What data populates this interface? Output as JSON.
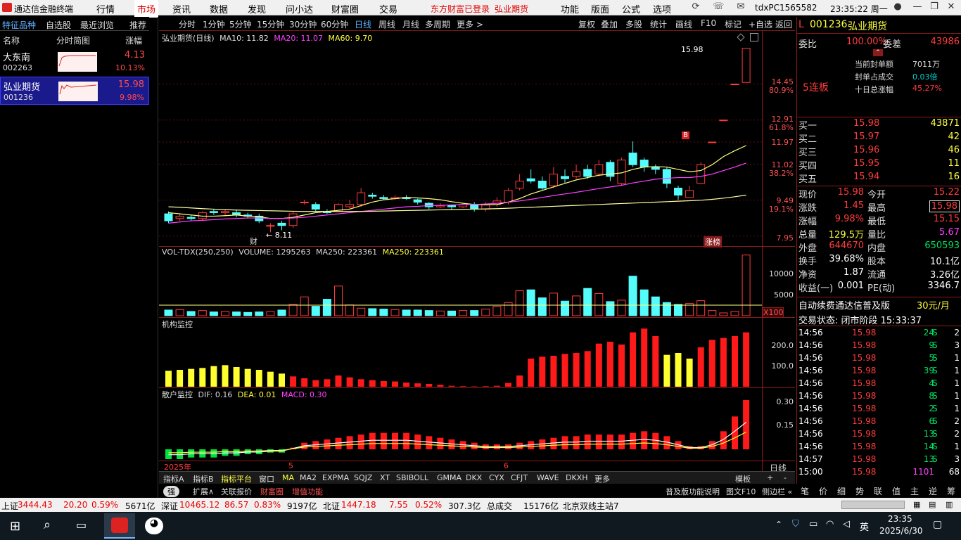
{
  "menubar": {
    "app_title": "通达信金融终端",
    "items": [
      "行情",
      "市场",
      "资讯",
      "数据",
      "发现",
      "问小达",
      "财富圈",
      "交易"
    ],
    "login": "东方财富已登录",
    "login_stock": "弘业期货",
    "items2": [
      "功能",
      "版面",
      "公式",
      "选项"
    ],
    "user": "tdxPC1565582",
    "clock": "23:35:22 周一"
  },
  "left_tabs": [
    "特征品种",
    "自选股",
    "最近浏览",
    "推荐"
  ],
  "left_header": {
    "name": "名称",
    "chart": "分时简图",
    "pct": "涨幅"
  },
  "stocks": [
    {
      "name": "大东南",
      "code": "002263",
      "price": "4.13",
      "pct": "10.13%"
    },
    {
      "name": "弘业期货",
      "code": "001236",
      "price": "15.98",
      "pct": "9.98%"
    }
  ],
  "toolbar": {
    "periods": [
      "分时",
      "1分钟",
      "5分钟",
      "15分钟",
      "30分钟",
      "60分钟",
      "日线",
      "周线",
      "月线",
      "多周期",
      "更多 >"
    ],
    "actions": [
      "复权",
      "叠加",
      "多股",
      "统计",
      "画线",
      "F10",
      "标记",
      "+自选",
      "返回"
    ]
  },
  "main_chart": {
    "title": "弘业期货(日线)",
    "ma10": "MA10: 11.82",
    "ma20": "MA20: 11.07",
    "ma60": "MA60: 9.70",
    "max_label": "15.98",
    "min_label": "← 8.11",
    "marker_b": "B",
    "marker_cai": "财",
    "badge": "涨榜"
  },
  "yaxis_main": [
    {
      "v": "14.45",
      "p": "80.9%"
    },
    {
      "v": "12.91",
      "p": "61.8%"
    },
    {
      "v": "11.97",
      "p": ""
    },
    {
      "v": "11.02",
      "p": "38.2%"
    },
    {
      "v": "9.49",
      "p": "19.1%"
    },
    {
      "v": "7.95",
      "p": ""
    }
  ],
  "vol_title": {
    "label": "VOL-TDX(250,250)",
    "volume": "VOLUME: 1295263",
    "ma1": "MA250: 223361",
    "ma2": "MA250: 223361"
  },
  "yaxis_vol": [
    "10000",
    "5000",
    "X100"
  ],
  "inst_title": "机构监控",
  "yaxis_inst": [
    "200.0",
    "100.0"
  ],
  "macd_title": {
    "label": "散户监控",
    "dif": "DIF: 0.16",
    "dea": "DEA: 0.01",
    "macd": "MACD: 0.30"
  },
  "yaxis_macd": [
    "0.30",
    "0.15"
  ],
  "date_axis": {
    "year": "2025年",
    "m5": "5",
    "m6": "6",
    "right": "日线"
  },
  "chart_data": {
    "type": "candlestick",
    "title": "弘业期货(日线)",
    "candles": [
      [
        8.9,
        8.6,
        9.0,
        8.5
      ],
      [
        8.7,
        8.8,
        8.9,
        8.6
      ],
      [
        8.75,
        8.7,
        8.85,
        8.6
      ],
      [
        8.7,
        8.95,
        9.0,
        8.6
      ],
      [
        9.0,
        8.95,
        9.1,
        8.85
      ],
      [
        8.95,
        9.0,
        9.1,
        8.8
      ],
      [
        8.95,
        8.85,
        9.05,
        8.75
      ],
      [
        8.85,
        8.8,
        8.95,
        8.7
      ],
      [
        8.8,
        8.6,
        8.9,
        8.5
      ],
      [
        8.4,
        8.4,
        8.5,
        8.11
      ],
      [
        8.5,
        8.4,
        8.6,
        8.2
      ],
      [
        8.4,
        8.9,
        9.0,
        8.3
      ],
      [
        9.4,
        9.4,
        9.5,
        9.3
      ],
      [
        9.3,
        9.1,
        9.4,
        9.0
      ],
      [
        9.0,
        8.95,
        9.1,
        8.9
      ],
      [
        9.0,
        9.3,
        9.35,
        9.0
      ],
      [
        9.2,
        9.3,
        9.5,
        9.1
      ],
      [
        9.3,
        9.8,
        10.0,
        9.2
      ],
      [
        9.7,
        9.65,
        9.8,
        9.55
      ],
      [
        9.6,
        9.55,
        9.7,
        9.5
      ],
      [
        9.55,
        9.6,
        9.7,
        9.5
      ],
      [
        9.6,
        9.55,
        9.7,
        9.5
      ],
      [
        9.5,
        9.4,
        9.55,
        9.3
      ],
      [
        9.35,
        9.2,
        9.4,
        9.1
      ],
      [
        9.2,
        9.25,
        9.35,
        9.15
      ],
      [
        9.25,
        9.2,
        9.3,
        9.1
      ],
      [
        9.2,
        9.3,
        9.35,
        9.15
      ],
      [
        9.3,
        9.1,
        9.4,
        9.0
      ],
      [
        9.1,
        9.3,
        9.4,
        9.0
      ],
      [
        9.3,
        9.45,
        9.6,
        9.2
      ],
      [
        9.4,
        9.9,
        10.0,
        9.3
      ],
      [
        10.0,
        10.3,
        10.6,
        9.9
      ],
      [
        10.4,
        10.3,
        10.8,
        10.2
      ],
      [
        10.3,
        10.0,
        10.5,
        9.9
      ],
      [
        10.1,
        10.6,
        10.9,
        10.0
      ],
      [
        10.5,
        10.4,
        10.8,
        10.2
      ],
      [
        10.5,
        10.7,
        11.0,
        10.4
      ],
      [
        10.8,
        10.5,
        11.0,
        10.4
      ],
      [
        10.6,
        11.0,
        11.2,
        10.5
      ],
      [
        11.1,
        10.5,
        11.2,
        10.3
      ],
      [
        10.2,
        11.2,
        11.3,
        10.1
      ],
      [
        11.5,
        11.0,
        12.0,
        10.9
      ],
      [
        11.2,
        10.9,
        11.3,
        10.7
      ],
      [
        10.9,
        10.8,
        11.0,
        10.6
      ],
      [
        10.8,
        10.2,
        10.9,
        10.0
      ],
      [
        10.0,
        9.7,
        10.1,
        9.5
      ],
      [
        9.6,
        9.9,
        10.1,
        9.6
      ],
      [
        10.2,
        11.0,
        11.1,
        10.2
      ],
      [
        11.97,
        11.97,
        11.97,
        11.97
      ],
      [
        12.91,
        12.91,
        12.91,
        12.91
      ],
      [
        14.45,
        14.45,
        14.45,
        14.45
      ],
      [
        14.52,
        15.98,
        15.98,
        14.52
      ]
    ],
    "ma10": [
      8.95,
      8.9,
      8.85,
      8.8,
      8.8,
      8.82,
      8.85,
      8.8,
      8.78,
      8.7,
      8.7,
      8.75,
      8.85,
      8.95,
      9.0,
      9.05,
      9.1,
      9.25,
      9.4,
      9.5,
      9.55,
      9.6,
      9.58,
      9.55,
      9.5,
      9.42,
      9.35,
      9.3,
      9.28,
      9.3,
      9.4,
      9.55,
      9.75,
      9.9,
      10.05,
      10.2,
      10.35,
      10.45,
      10.55,
      10.6,
      10.65,
      10.8,
      10.9,
      10.92,
      10.9,
      10.8,
      10.7,
      10.75,
      11.0,
      11.35,
      11.6,
      11.82
    ],
    "ma20": [
      8.5,
      8.55,
      8.6,
      8.62,
      8.65,
      8.68,
      8.7,
      8.72,
      8.72,
      8.7,
      8.7,
      8.72,
      8.75,
      8.8,
      8.85,
      8.9,
      8.95,
      9.0,
      9.05,
      9.1,
      9.15,
      9.2,
      9.22,
      9.25,
      9.26,
      9.28,
      9.3,
      9.3,
      9.32,
      9.35,
      9.4,
      9.45,
      9.52,
      9.6,
      9.68,
      9.75,
      9.82,
      9.9,
      9.98,
      10.05,
      10.12,
      10.22,
      10.3,
      10.38,
      10.42,
      10.45,
      10.45,
      10.5,
      10.6,
      10.75,
      10.9,
      11.07
    ],
    "ma60": [
      9.2,
      9.18,
      9.15,
      9.12,
      9.1,
      9.08,
      9.06,
      9.05,
      9.04,
      9.03,
      9.02,
      9.01,
      9.0,
      9.0,
      9.0,
      9.0,
      9.0,
      9.0,
      9.01,
      9.02,
      9.03,
      9.04,
      9.05,
      9.06,
      9.07,
      9.08,
      9.09,
      9.1,
      9.11,
      9.12,
      9.14,
      9.16,
      9.18,
      9.2,
      9.22,
      9.24,
      9.26,
      9.28,
      9.3,
      9.32,
      9.34,
      9.36,
      9.38,
      9.4,
      9.42,
      9.44,
      9.46,
      9.48,
      9.52,
      9.57,
      9.63,
      9.7
    ],
    "volume": [
      1200,
      1300,
      900,
      1100,
      800,
      900,
      800,
      700,
      800,
      900,
      1200,
      2400,
      4000,
      2000,
      3500,
      6300,
      2300,
      1600,
      1500,
      1400,
      1300,
      1200,
      1200,
      1100,
      1000,
      1000,
      1100,
      1100,
      1400,
      2000,
      2800,
      5300,
      5500,
      3800,
      4800,
      3100,
      4200,
      5800,
      4700,
      3000,
      3300,
      8400,
      5500,
      4000,
      2800,
      2400,
      2600,
      3200,
      1100,
      600,
      900,
      12900
    ],
    "institution": [
      85,
      90,
      95,
      100,
      110,
      115,
      105,
      95,
      90,
      80,
      70,
      55,
      45,
      35,
      40,
      60,
      50,
      40,
      35,
      30,
      28,
      22,
      18,
      15,
      10,
      5,
      3,
      2,
      3,
      5,
      20,
      60,
      150,
      160,
      165,
      175,
      180,
      190,
      230,
      240,
      225,
      290,
      310,
      270,
      170,
      180,
      150,
      210,
      250,
      260,
      270,
      290
    ],
    "macd": [
      -0.06,
      -0.06,
      -0.05,
      -0.05,
      -0.05,
      -0.04,
      -0.04,
      -0.03,
      -0.03,
      -0.02,
      -0.02,
      0.01,
      0.04,
      0.05,
      0.06,
      0.07,
      0.08,
      0.09,
      0.1,
      0.1,
      0.1,
      0.1,
      0.09,
      0.08,
      0.07,
      0.06,
      0.05,
      0.04,
      0.03,
      0.03,
      0.03,
      0.04,
      0.05,
      0.06,
      0.07,
      0.08,
      0.08,
      0.09,
      0.09,
      0.09,
      0.09,
      0.1,
      0.11,
      0.1,
      0.08,
      0.05,
      0.02,
      0.02,
      0.05,
      0.11,
      0.2,
      0.3
    ]
  },
  "right_panel": {
    "code": "001236",
    "name": "弘业期货",
    "weibi_label": "委比",
    "weibi": "100.00%",
    "weicha_label": "委差",
    "weicha": "43986",
    "seal_amt_label": "当前封单额",
    "seal_amt": "7011万",
    "seal_ratio_label": "封单占成交",
    "seal_ratio": "0.03倍",
    "ten_day_label": "十日总涨幅",
    "ten_day": "45.27%",
    "streak": "5连板",
    "bids": [
      {
        "l": "买一",
        "p": "15.98",
        "v": "43871"
      },
      {
        "l": "买二",
        "p": "15.97",
        "v": "42"
      },
      {
        "l": "买三",
        "p": "15.96",
        "v": "46"
      },
      {
        "l": "买四",
        "p": "15.95",
        "v": "11"
      },
      {
        "l": "买五",
        "p": "15.94",
        "v": "16"
      }
    ],
    "quote": [
      {
        "l": "现价",
        "v": "15.98",
        "l2": "今开",
        "v2": "15.22"
      },
      {
        "l": "涨跌",
        "v": "1.45",
        "l2": "最高",
        "v2": "15.98"
      },
      {
        "l": "涨幅",
        "v": "9.98%",
        "l2": "最低",
        "v2": "15.15"
      },
      {
        "l": "总量",
        "v": "129.5万",
        "l2": "量比",
        "v2": "5.67"
      },
      {
        "l": "外盘",
        "v": "644670",
        "l2": "内盘",
        "v2": "650593"
      },
      {
        "l": "换手",
        "v": "39.68%",
        "l2": "股本",
        "v2": "10.1亿"
      },
      {
        "l": "净资",
        "v": "1.87",
        "l2": "流通",
        "v2": "3.26亿"
      },
      {
        "l": "收益(一)",
        "v": "0.001",
        "l2": "PE(动)",
        "v2": "3346.7"
      }
    ],
    "ad": "自动续费通达信普及版",
    "ad_price": "30元/月",
    "trade_status": "交易状态: 闭市阶段 15:33:37",
    "ticks": [
      {
        "t": "14:56",
        "p": "15.98",
        "v": "24",
        "s": "S",
        "n": "2"
      },
      {
        "t": "14:56",
        "p": "15.98",
        "v": "9",
        "s": "S",
        "n": "3"
      },
      {
        "t": "14:56",
        "p": "15.98",
        "v": "5",
        "s": "S",
        "n": "1"
      },
      {
        "t": "14:56",
        "p": "15.98",
        "v": "39",
        "s": "S",
        "n": "1"
      },
      {
        "t": "14:56",
        "p": "15.98",
        "v": "4",
        "s": "S",
        "n": "1"
      },
      {
        "t": "14:56",
        "p": "15.98",
        "v": "8",
        "s": "S",
        "n": "1"
      },
      {
        "t": "14:56",
        "p": "15.98",
        "v": "2",
        "s": "S",
        "n": "1"
      },
      {
        "t": "14:56",
        "p": "15.98",
        "v": "6",
        "s": "S",
        "n": "2"
      },
      {
        "t": "14:56",
        "p": "15.98",
        "v": "13",
        "s": "S",
        "n": "2"
      },
      {
        "t": "14:56",
        "p": "15.98",
        "v": "14",
        "s": "S",
        "n": "1"
      },
      {
        "t": "14:57",
        "p": "15.98",
        "v": "13",
        "s": "S",
        "n": "3"
      },
      {
        "t": "15:00",
        "p": "15.98",
        "v": "1101",
        "s": "",
        "n": "68"
      }
    ],
    "bottom_tabs": [
      "笔",
      "价",
      "细",
      "势",
      "联",
      "值",
      "主",
      "逆",
      "筹"
    ]
  },
  "indicator_tabs": [
    "指标A",
    "指标B",
    "指标平台",
    "窗口",
    "MA",
    "MA2",
    "EXPMA",
    "SQJZ",
    "XT",
    "SBIBOLL",
    "GMMA",
    "DKX",
    "CYX",
    "CFJT",
    "WAVE",
    "DKXH",
    "更多"
  ],
  "indicator_tabs_right": [
    "模板",
    "+",
    "-"
  ],
  "bottom_bar": {
    "toggle": "强",
    "items": [
      "扩展∧",
      "关联报价",
      "财富圈",
      "增值功能"
    ],
    "right1": "普及版功能说明",
    "right2": "图文F10",
    "right3": "侧边栏 «"
  },
  "status": {
    "sh_label": "上证",
    "sh": "3444.43",
    "sh_chg": "20.20",
    "sh_pct": "0.59%",
    "sh_amt": "5671亿",
    "sz_label": "深证",
    "sz": "10465.12",
    "sz_chg": "86.57",
    "sz_pct": "0.83%",
    "sz_amt": "9197亿",
    "bz_label": "北证",
    "bz": "1447.18",
    "bz_chg": "7.55",
    "bz_pct": "0.52%",
    "bz_amt": "307.3亿",
    "total_label": "总成交",
    "total": "15176亿",
    "server": "北京双线主站7"
  },
  "taskbar": {
    "time": "23:35",
    "date": "2025/6/30",
    "lang": "英"
  }
}
